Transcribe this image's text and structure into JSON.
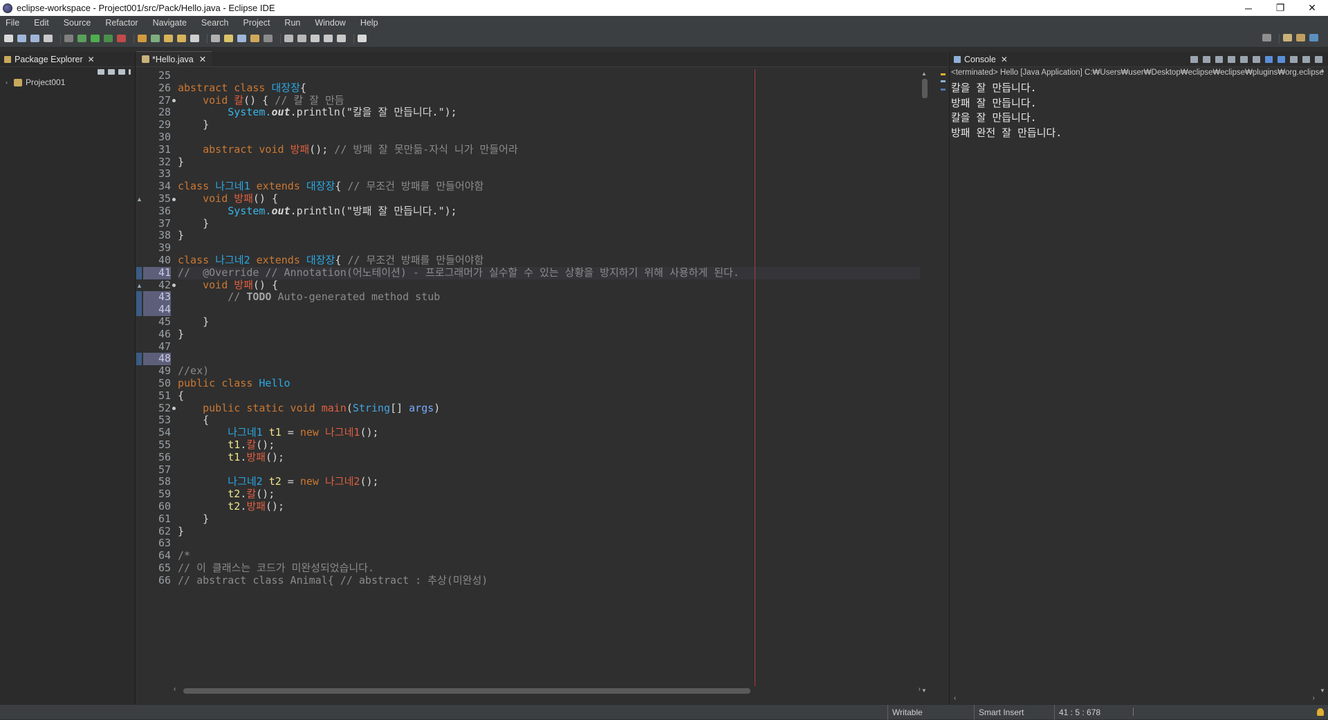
{
  "window": {
    "title": "eclipse-workspace - Project001/src/Pack/Hello.java - Eclipse IDE",
    "controls": [
      "─",
      "❐",
      "✕"
    ]
  },
  "menu": [
    "File",
    "Edit",
    "Source",
    "Refactor",
    "Navigate",
    "Search",
    "Project",
    "Run",
    "Window",
    "Help"
  ],
  "package_explorer": {
    "tab_label": "Package Explorer",
    "close": "✕",
    "items": [
      {
        "label": "Project001",
        "twisty": "›"
      }
    ]
  },
  "editor": {
    "tab_label": "*Hello.java",
    "close": "✕",
    "lines": [
      {
        "no": "25",
        "segs": []
      },
      {
        "no": "26",
        "segs": [
          [
            "kw",
            "abstract class "
          ],
          [
            "cls",
            "대장장"
          ],
          [
            "",
            "{"
          ]
        ]
      },
      {
        "no": "27",
        "fold": true,
        "segs": [
          [
            "",
            "    "
          ],
          [
            "kw",
            "void "
          ],
          [
            "mth",
            "칼"
          ],
          [
            "",
            "() { "
          ],
          [
            "cm",
            "// 칼 잘 만듬"
          ]
        ]
      },
      {
        "no": "28",
        "segs": [
          [
            "",
            "        "
          ],
          [
            "sysout",
            "System."
          ],
          [
            "fld",
            "out"
          ],
          [
            "",
            ".println(\"칼을 잘 만듭니다.\");"
          ]
        ]
      },
      {
        "no": "29",
        "segs": [
          [
            "",
            "    }"
          ]
        ]
      },
      {
        "no": "30",
        "segs": []
      },
      {
        "no": "31",
        "segs": [
          [
            "",
            "    "
          ],
          [
            "kw",
            "abstract void "
          ],
          [
            "mth",
            "방패"
          ],
          [
            "",
            "(); "
          ],
          [
            "cm",
            "// 방패 잘 못만듦-자식 니가 만들어라"
          ]
        ]
      },
      {
        "no": "32",
        "segs": [
          [
            "",
            "}"
          ]
        ]
      },
      {
        "no": "33",
        "segs": []
      },
      {
        "no": "34",
        "segs": [
          [
            "kw",
            "class "
          ],
          [
            "cls",
            "나그네1 "
          ],
          [
            "kw",
            "extends "
          ],
          [
            "cls",
            "대장장"
          ],
          [
            "",
            "{ "
          ],
          [
            "cm",
            "// 무조건 방패를 만들어야함"
          ]
        ]
      },
      {
        "no": "35",
        "fold": true,
        "override": true,
        "segs": [
          [
            "",
            "    "
          ],
          [
            "kw",
            "void "
          ],
          [
            "mth",
            "방패"
          ],
          [
            "",
            "() {"
          ]
        ]
      },
      {
        "no": "36",
        "segs": [
          [
            "",
            "        "
          ],
          [
            "sysout",
            "System."
          ],
          [
            "fld",
            "out"
          ],
          [
            "",
            ".println(\"방패 잘 만듭니다.\");"
          ]
        ]
      },
      {
        "no": "37",
        "segs": [
          [
            "",
            "    }"
          ]
        ]
      },
      {
        "no": "38",
        "segs": [
          [
            "",
            "}"
          ]
        ]
      },
      {
        "no": "39",
        "segs": []
      },
      {
        "no": "40",
        "segs": [
          [
            "kw",
            "class "
          ],
          [
            "cls",
            "나그네2 "
          ],
          [
            "kw",
            "extends "
          ],
          [
            "cls",
            "대장장"
          ],
          [
            "",
            "{ "
          ],
          [
            "cm",
            "// 무조건 방패를 만들어야함"
          ]
        ]
      },
      {
        "no": "41",
        "current": true,
        "sel": true,
        "segs": [
          [
            "cm",
            "//  @Override // Annotation(어노테이션) - 프로그래머가 실수할 수 있는 상황을 방지하기 위해 사용하게 된다."
          ]
        ]
      },
      {
        "no": "42",
        "fold": true,
        "override": true,
        "segs": [
          [
            "",
            "    "
          ],
          [
            "kw",
            "void "
          ],
          [
            "mth",
            "방패"
          ],
          [
            "",
            "() {"
          ]
        ]
      },
      {
        "no": "43",
        "sel": true,
        "segs": [
          [
            "",
            "        "
          ],
          [
            "cm",
            "// "
          ],
          [
            "todo",
            "TODO"
          ],
          [
            "cm",
            " Auto-generated method stub"
          ]
        ]
      },
      {
        "no": "44",
        "sel": true,
        "segs": []
      },
      {
        "no": "45",
        "segs": [
          [
            "",
            "    }"
          ]
        ]
      },
      {
        "no": "46",
        "segs": [
          [
            "",
            "}"
          ]
        ]
      },
      {
        "no": "47",
        "segs": []
      },
      {
        "no": "48",
        "sel": true,
        "segs": []
      },
      {
        "no": "49",
        "segs": [
          [
            "cm",
            "//ex)"
          ]
        ]
      },
      {
        "no": "50",
        "segs": [
          [
            "kw",
            "public class "
          ],
          [
            "cls",
            "Hello"
          ]
        ]
      },
      {
        "no": "51",
        "segs": [
          [
            "",
            "{"
          ]
        ]
      },
      {
        "no": "52",
        "fold": true,
        "segs": [
          [
            "",
            "    "
          ],
          [
            "kw",
            "public static void "
          ],
          [
            "mth",
            "main"
          ],
          [
            "",
            "("
          ],
          [
            "typ",
            "String"
          ],
          [
            "",
            "[] "
          ],
          [
            "prm",
            "args"
          ],
          [
            "",
            ")"
          ]
        ]
      },
      {
        "no": "53",
        "segs": [
          [
            "",
            "    {"
          ]
        ]
      },
      {
        "no": "54",
        "segs": [
          [
            "",
            "        "
          ],
          [
            "cls",
            "나그네1 "
          ],
          [
            "var",
            "t1"
          ],
          [
            "",
            " = "
          ],
          [
            "kw",
            "new "
          ],
          [
            "mth",
            "나그네1"
          ],
          [
            "",
            "();"
          ]
        ]
      },
      {
        "no": "55",
        "segs": [
          [
            "",
            "        "
          ],
          [
            "var",
            "t1"
          ],
          [
            "",
            "."
          ],
          [
            "mth",
            "칼"
          ],
          [
            "",
            "();"
          ]
        ]
      },
      {
        "no": "56",
        "segs": [
          [
            "",
            "        "
          ],
          [
            "var",
            "t1"
          ],
          [
            "",
            "."
          ],
          [
            "mth",
            "방패"
          ],
          [
            "",
            "();"
          ]
        ]
      },
      {
        "no": "57",
        "segs": []
      },
      {
        "no": "58",
        "segs": [
          [
            "",
            "        "
          ],
          [
            "cls",
            "나그네2 "
          ],
          [
            "var",
            "t2"
          ],
          [
            "",
            " = "
          ],
          [
            "kw",
            "new "
          ],
          [
            "mth",
            "나그네2"
          ],
          [
            "",
            "();"
          ]
        ]
      },
      {
        "no": "59",
        "segs": [
          [
            "",
            "        "
          ],
          [
            "var",
            "t2"
          ],
          [
            "",
            "."
          ],
          [
            "mth",
            "칼"
          ],
          [
            "",
            "();"
          ]
        ]
      },
      {
        "no": "60",
        "segs": [
          [
            "",
            "        "
          ],
          [
            "var",
            "t2"
          ],
          [
            "",
            "."
          ],
          [
            "mth",
            "방패"
          ],
          [
            "",
            "();"
          ]
        ]
      },
      {
        "no": "61",
        "segs": [
          [
            "",
            "    }"
          ]
        ]
      },
      {
        "no": "62",
        "segs": [
          [
            "",
            "}"
          ]
        ]
      },
      {
        "no": "63",
        "segs": []
      },
      {
        "no": "64",
        "segs": [
          [
            "cm",
            "/*"
          ]
        ]
      },
      {
        "no": "65",
        "segs": [
          [
            "cm",
            "// 이 클래스는 코드가 미완성되었습니다."
          ]
        ]
      },
      {
        "no": "66",
        "segs": [
          [
            "cm",
            "// abstract class Animal{ // abstract : 추상(미완성)"
          ]
        ]
      }
    ]
  },
  "console": {
    "tab_label": "Console",
    "close": "✕",
    "header": "<terminated> Hello [Java Application] C:₩Users₩user₩Desktop₩eclipse₩eclipse₩plugins₩org.eclipse",
    "lines": [
      "칼을 잘 만듭니다.",
      "방패 잘 만듭니다.",
      "칼을 잘 만듭니다.",
      "방패 완전 잘 만듭니다."
    ]
  },
  "statusbar": {
    "mode": "Writable",
    "insert": "Smart Insert",
    "position": "41 : 5 : 678"
  },
  "colors": {
    "keyword": "#cc7832",
    "class_name": "#2aa9e6",
    "method": "#e06040",
    "comment": "#8b8b8b",
    "print_margin": "#b03a3a",
    "background": "#2f2f2f"
  }
}
